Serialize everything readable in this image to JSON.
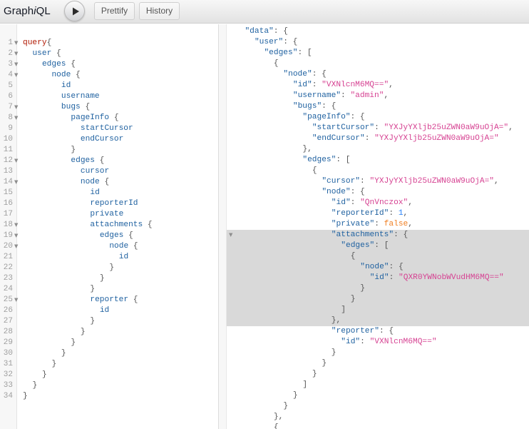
{
  "toolbar": {
    "title_pre": "Graph",
    "title_em": "i",
    "title_post": "QL",
    "execute_icon": "play-icon",
    "prettify_label": "Prettify",
    "history_label": "History"
  },
  "query_lines": [
    {
      "num": "1",
      "fold": true,
      "indent": 0,
      "tokens": [
        [
          "kw",
          "query"
        ],
        [
          "punct",
          "{"
        ]
      ]
    },
    {
      "num": "2",
      "fold": true,
      "indent": 1,
      "tokens": [
        [
          "field",
          "user"
        ],
        [
          "punct",
          " {"
        ]
      ]
    },
    {
      "num": "3",
      "fold": true,
      "indent": 2,
      "tokens": [
        [
          "field",
          "edges"
        ],
        [
          "punct",
          " {"
        ]
      ]
    },
    {
      "num": "4",
      "fold": true,
      "indent": 3,
      "tokens": [
        [
          "field",
          "node"
        ],
        [
          "punct",
          " {"
        ]
      ]
    },
    {
      "num": "5",
      "fold": false,
      "indent": 4,
      "tokens": [
        [
          "field",
          "id"
        ]
      ]
    },
    {
      "num": "6",
      "fold": false,
      "indent": 4,
      "tokens": [
        [
          "field",
          "username"
        ]
      ]
    },
    {
      "num": "7",
      "fold": true,
      "indent": 4,
      "tokens": [
        [
          "field",
          "bugs"
        ],
        [
          "punct",
          " {"
        ]
      ]
    },
    {
      "num": "8",
      "fold": true,
      "indent": 5,
      "tokens": [
        [
          "field",
          "pageInfo"
        ],
        [
          "punct",
          " {"
        ]
      ]
    },
    {
      "num": "9",
      "fold": false,
      "indent": 6,
      "tokens": [
        [
          "field",
          "startCursor"
        ]
      ]
    },
    {
      "num": "10",
      "fold": false,
      "indent": 6,
      "tokens": [
        [
          "field",
          "endCursor"
        ]
      ]
    },
    {
      "num": "11",
      "fold": false,
      "indent": 5,
      "tokens": [
        [
          "punct",
          "}"
        ]
      ]
    },
    {
      "num": "12",
      "fold": true,
      "indent": 5,
      "tokens": [
        [
          "field",
          "edges"
        ],
        [
          "punct",
          " {"
        ]
      ]
    },
    {
      "num": "13",
      "fold": false,
      "indent": 6,
      "tokens": [
        [
          "field",
          "cursor"
        ]
      ]
    },
    {
      "num": "14",
      "fold": true,
      "indent": 6,
      "tokens": [
        [
          "field",
          "node"
        ],
        [
          "punct",
          " {"
        ]
      ]
    },
    {
      "num": "15",
      "fold": false,
      "indent": 7,
      "tokens": [
        [
          "field",
          "id"
        ]
      ]
    },
    {
      "num": "16",
      "fold": false,
      "indent": 7,
      "tokens": [
        [
          "field",
          "reporterId"
        ]
      ]
    },
    {
      "num": "17",
      "fold": false,
      "indent": 7,
      "tokens": [
        [
          "field",
          "private"
        ]
      ]
    },
    {
      "num": "18",
      "fold": true,
      "indent": 7,
      "tokens": [
        [
          "field",
          "attachments"
        ],
        [
          "punct",
          " {"
        ]
      ]
    },
    {
      "num": "19",
      "fold": true,
      "indent": 8,
      "tokens": [
        [
          "field",
          "edges"
        ],
        [
          "punct",
          " {"
        ]
      ]
    },
    {
      "num": "20",
      "fold": true,
      "indent": 9,
      "tokens": [
        [
          "field",
          "node"
        ],
        [
          "punct",
          " {"
        ]
      ]
    },
    {
      "num": "21",
      "fold": false,
      "indent": 10,
      "tokens": [
        [
          "field",
          "id"
        ]
      ]
    },
    {
      "num": "22",
      "fold": false,
      "indent": 9,
      "tokens": [
        [
          "punct",
          "}"
        ]
      ]
    },
    {
      "num": "23",
      "fold": false,
      "indent": 8,
      "tokens": [
        [
          "punct",
          "}"
        ]
      ]
    },
    {
      "num": "24",
      "fold": false,
      "indent": 7,
      "tokens": [
        [
          "punct",
          "}"
        ]
      ]
    },
    {
      "num": "25",
      "fold": true,
      "indent": 7,
      "tokens": [
        [
          "field",
          "reporter"
        ],
        [
          "punct",
          " {"
        ]
      ]
    },
    {
      "num": "26",
      "fold": false,
      "indent": 8,
      "tokens": [
        [
          "field",
          "id"
        ]
      ]
    },
    {
      "num": "27",
      "fold": false,
      "indent": 7,
      "tokens": [
        [
          "punct",
          "}"
        ]
      ]
    },
    {
      "num": "28",
      "fold": false,
      "indent": 6,
      "tokens": [
        [
          "punct",
          "}"
        ]
      ]
    },
    {
      "num": "29",
      "fold": false,
      "indent": 5,
      "tokens": [
        [
          "punct",
          "}"
        ]
      ]
    },
    {
      "num": "30",
      "fold": false,
      "indent": 4,
      "tokens": [
        [
          "punct",
          "}"
        ]
      ]
    },
    {
      "num": "31",
      "fold": false,
      "indent": 3,
      "tokens": [
        [
          "punct",
          "}"
        ]
      ]
    },
    {
      "num": "32",
      "fold": false,
      "indent": 2,
      "tokens": [
        [
          "punct",
          "}"
        ]
      ]
    },
    {
      "num": "33",
      "fold": false,
      "indent": 1,
      "tokens": [
        [
          "punct",
          "}"
        ]
      ]
    },
    {
      "num": "34",
      "fold": false,
      "indent": 0,
      "tokens": [
        [
          "punct",
          "}"
        ]
      ]
    }
  ],
  "result_lines": [
    {
      "fold": false,
      "indent": 1,
      "tokens": [
        [
          "jkey",
          "\"data\""
        ],
        [
          "jp",
          ": {"
        ]
      ]
    },
    {
      "fold": false,
      "indent": 2,
      "tokens": [
        [
          "jkey",
          "\"user\""
        ],
        [
          "jp",
          ": {"
        ]
      ]
    },
    {
      "fold": false,
      "indent": 3,
      "tokens": [
        [
          "jkey",
          "\"edges\""
        ],
        [
          "jp",
          ": ["
        ]
      ]
    },
    {
      "fold": false,
      "indent": 4,
      "tokens": [
        [
          "jp",
          "{"
        ]
      ]
    },
    {
      "fold": false,
      "indent": 5,
      "tokens": [
        [
          "jkey",
          "\"node\""
        ],
        [
          "jp",
          ": {"
        ]
      ]
    },
    {
      "fold": false,
      "indent": 6,
      "tokens": [
        [
          "jkey",
          "\"id\""
        ],
        [
          "jp",
          ": "
        ],
        [
          "jstr",
          "\"VXNlcnM6MQ==\""
        ],
        [
          "jp",
          ","
        ]
      ]
    },
    {
      "fold": false,
      "indent": 6,
      "tokens": [
        [
          "jkey",
          "\"username\""
        ],
        [
          "jp",
          ": "
        ],
        [
          "jstr",
          "\"admin\""
        ],
        [
          "jp",
          ","
        ]
      ]
    },
    {
      "fold": false,
      "indent": 6,
      "tokens": [
        [
          "jkey",
          "\"bugs\""
        ],
        [
          "jp",
          ": {"
        ]
      ]
    },
    {
      "fold": false,
      "indent": 7,
      "tokens": [
        [
          "jkey",
          "\"pageInfo\""
        ],
        [
          "jp",
          ": {"
        ]
      ]
    },
    {
      "fold": false,
      "indent": 8,
      "tokens": [
        [
          "jkey",
          "\"startCursor\""
        ],
        [
          "jp",
          ": "
        ],
        [
          "jstr",
          "\"YXJyYXljb25uZWN0aW9uOjA=\""
        ],
        [
          "jp",
          ","
        ]
      ]
    },
    {
      "fold": false,
      "indent": 8,
      "tokens": [
        [
          "jkey",
          "\"endCursor\""
        ],
        [
          "jp",
          ": "
        ],
        [
          "jstr",
          "\"YXJyYXljb25uZWN0aW9uOjA=\""
        ]
      ]
    },
    {
      "fold": false,
      "indent": 7,
      "tokens": [
        [
          "jp",
          "},"
        ]
      ]
    },
    {
      "fold": false,
      "indent": 7,
      "tokens": [
        [
          "jkey",
          "\"edges\""
        ],
        [
          "jp",
          ": ["
        ]
      ]
    },
    {
      "fold": false,
      "indent": 8,
      "tokens": [
        [
          "jp",
          "{"
        ]
      ]
    },
    {
      "fold": false,
      "indent": 9,
      "tokens": [
        [
          "jkey",
          "\"cursor\""
        ],
        [
          "jp",
          ": "
        ],
        [
          "jstr",
          "\"YXJyYXljb25uZWN0aW9uOjA=\""
        ],
        [
          "jp",
          ","
        ]
      ]
    },
    {
      "fold": false,
      "indent": 9,
      "tokens": [
        [
          "jkey",
          "\"node\""
        ],
        [
          "jp",
          ": {"
        ]
      ]
    },
    {
      "fold": false,
      "indent": 10,
      "tokens": [
        [
          "jkey",
          "\"id\""
        ],
        [
          "jp",
          ": "
        ],
        [
          "jstr",
          "\"QnVnczox\""
        ],
        [
          "jp",
          ","
        ]
      ]
    },
    {
      "fold": false,
      "indent": 10,
      "tokens": [
        [
          "jkey",
          "\"reporterId\""
        ],
        [
          "jp",
          ": "
        ],
        [
          "jnum",
          "1"
        ],
        [
          "jp",
          ","
        ]
      ]
    },
    {
      "fold": false,
      "indent": 10,
      "tokens": [
        [
          "jkey",
          "\"private\""
        ],
        [
          "jp",
          ": "
        ],
        [
          "jbool",
          "false"
        ],
        [
          "jp",
          ","
        ]
      ]
    },
    {
      "fold": true,
      "indent": 10,
      "tokens": [
        [
          "jkey",
          "\"attachments\""
        ],
        [
          "jp",
          ": {"
        ]
      ]
    },
    {
      "fold": false,
      "indent": 11,
      "tokens": [
        [
          "jkey",
          "\"edges\""
        ],
        [
          "jp",
          ": ["
        ]
      ]
    },
    {
      "fold": false,
      "indent": 12,
      "tokens": [
        [
          "jp",
          "{"
        ]
      ]
    },
    {
      "fold": false,
      "indent": 13,
      "tokens": [
        [
          "jkey",
          "\"node\""
        ],
        [
          "jp",
          ": {"
        ]
      ]
    },
    {
      "fold": false,
      "indent": 14,
      "tokens": [
        [
          "jkey",
          "\"id\""
        ],
        [
          "jp",
          ": "
        ],
        [
          "jstr",
          "\"QXR0YWNobWVudHM6MQ==\""
        ]
      ]
    },
    {
      "fold": false,
      "indent": 13,
      "tokens": [
        [
          "jp",
          "}"
        ]
      ]
    },
    {
      "fold": false,
      "indent": 12,
      "tokens": [
        [
          "jp",
          "}"
        ]
      ]
    },
    {
      "fold": false,
      "indent": 11,
      "tokens": [
        [
          "jp",
          "]"
        ]
      ]
    },
    {
      "fold": false,
      "indent": 10,
      "tokens": [
        [
          "jp",
          "},"
        ]
      ]
    },
    {
      "fold": false,
      "indent": 10,
      "tokens": [
        [
          "jkey",
          "\"reporter\""
        ],
        [
          "jp",
          ": {"
        ]
      ]
    },
    {
      "fold": false,
      "indent": 11,
      "tokens": [
        [
          "jkey",
          "\"id\""
        ],
        [
          "jp",
          ": "
        ],
        [
          "jstr",
          "\"VXNlcnM6MQ==\""
        ]
      ]
    },
    {
      "fold": false,
      "indent": 10,
      "tokens": [
        [
          "jp",
          "}"
        ]
      ]
    },
    {
      "fold": false,
      "indent": 9,
      "tokens": [
        [
          "jp",
          "}"
        ]
      ]
    },
    {
      "fold": false,
      "indent": 8,
      "tokens": [
        [
          "jp",
          "}"
        ]
      ]
    },
    {
      "fold": false,
      "indent": 7,
      "tokens": [
        [
          "jp",
          "]"
        ]
      ]
    },
    {
      "fold": false,
      "indent": 6,
      "tokens": [
        [
          "jp",
          "}"
        ]
      ]
    },
    {
      "fold": false,
      "indent": 5,
      "tokens": [
        [
          "jp",
          "}"
        ]
      ]
    },
    {
      "fold": false,
      "indent": 4,
      "tokens": [
        [
          "jp",
          "},"
        ]
      ]
    },
    {
      "fold": false,
      "indent": 4,
      "tokens": [
        [
          "jp",
          "{"
        ]
      ]
    }
  ],
  "result_highlight": {
    "start": 19,
    "end": 27
  },
  "colors": {
    "keyword": "#b11a04",
    "field": "#1f61a0",
    "string": "#d64292",
    "number": "#2882f9",
    "boolean": "#f07f22",
    "selection": "#d9d9d9"
  }
}
